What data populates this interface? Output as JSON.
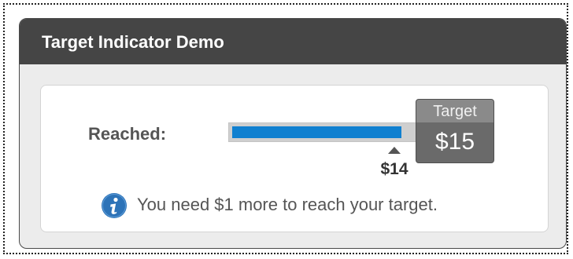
{
  "panel": {
    "title": "Target Indicator Demo"
  },
  "progress": {
    "label": "Reached:",
    "reached_value": "$14",
    "reached_amount": 14,
    "target_amount": 15,
    "fill_fraction": 0.913
  },
  "target": {
    "label": "Target",
    "value": "$15"
  },
  "message": {
    "text": "You need $1 more to reach your target."
  },
  "icons": {
    "info": "info-icon"
  },
  "colors": {
    "header_bg": "#454545",
    "progress_fill": "#1080d0",
    "target_box": "#6a6a6a",
    "info_icon": "#2d73b8"
  }
}
